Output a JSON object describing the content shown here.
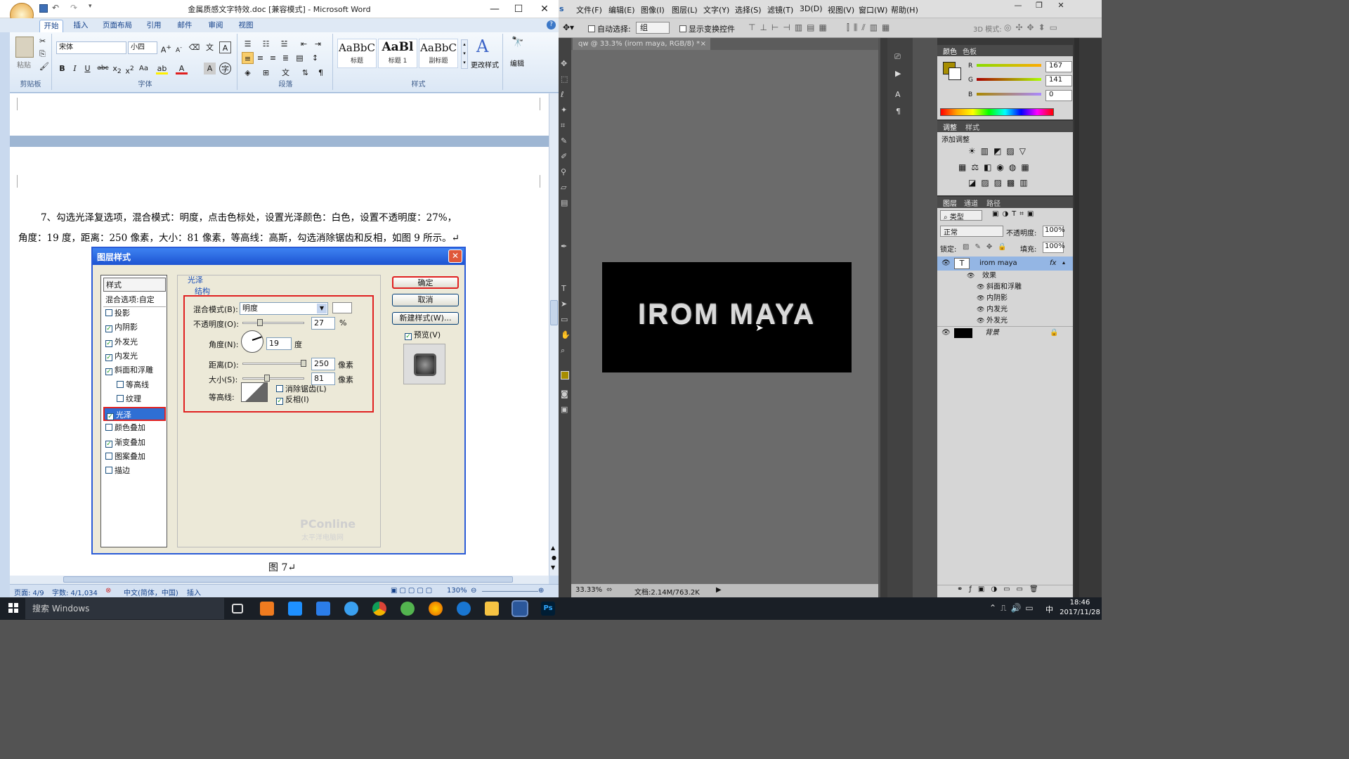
{
  "word": {
    "title": "金属质感文字特效.doc [兼容模式] - Microsoft Word",
    "tabs": [
      "开始",
      "插入",
      "页面布局",
      "引用",
      "邮件",
      "审阅",
      "视图"
    ],
    "font_name": "宋体",
    "font_size": "小四",
    "clipboard_group": "剪贴板",
    "paste_label": "粘贴",
    "font_group": "字体",
    "paragraph_group": "段落",
    "styles_group": "样式",
    "styles": [
      {
        "preview": "AaBbC",
        "name": "标题"
      },
      {
        "preview": "AaBl",
        "name": "标题 1"
      },
      {
        "preview": "AaBbC",
        "name": "副标题"
      }
    ],
    "change_styles": "更改样式",
    "edit_label": "编辑",
    "para_line1": "7、勾选光泽复选项，混合模式：明度，点击色标处，设置光泽颜色：白色，设置不透明度：27%，",
    "para_line2": "角度：19 度，距离：250 像素，大小：81 像素，等高线：高斯，勾选消除锯齿和反相，如图 9 所示。↵",
    "caption": "图 7↵",
    "status": {
      "page": "页面: 4/9",
      "words": "字数: 4/1,034",
      "lang": "中文(简体，中国)",
      "mode": "插入",
      "zoom": "130%"
    },
    "dialog": {
      "title": "图层样式",
      "list": [
        {
          "label": "样式",
          "checked": null
        },
        {
          "label": "混合选项:自定",
          "checked": null
        },
        {
          "label": "投影",
          "checked": false
        },
        {
          "label": "内阴影",
          "checked": true
        },
        {
          "label": "外发光",
          "checked": true
        },
        {
          "label": "内发光",
          "checked": true
        },
        {
          "label": "斜面和浮雕",
          "checked": true
        },
        {
          "label": "等高线",
          "checked": false
        },
        {
          "label": "纹理",
          "checked": false
        },
        {
          "label": "光泽",
          "checked": true
        },
        {
          "label": "颜色叠加",
          "checked": false
        },
        {
          "label": "渐变叠加",
          "checked": true
        },
        {
          "label": "图案叠加",
          "checked": false
        },
        {
          "label": "描边",
          "checked": false
        }
      ],
      "section": "光泽",
      "subsection": "结构",
      "blend_label": "混合模式(B):",
      "blend_value": "明度",
      "opacity_label": "不透明度(O):",
      "opacity_value": "27",
      "percent": "%",
      "angle_label": "角度(N):",
      "angle_value": "19",
      "degree": "度",
      "distance_label": "距离(D):",
      "distance_value": "250",
      "size_label": "大小(S):",
      "size_value": "81",
      "pixel": "像素",
      "contour_label": "等高线:",
      "antialias": "消除锯齿(L)",
      "invert": "反相(I)",
      "ok": "确定",
      "cancel": "取消",
      "new_style": "新建样式(W)...",
      "preview": "预览(V)",
      "watermark": "PConline",
      "watermark_sub": "太平洋电脑网"
    }
  },
  "ps": {
    "menu": [
      "文件(F)",
      "编辑(E)",
      "图像(I)",
      "图层(L)",
      "文字(Y)",
      "选择(S)",
      "滤镜(T)",
      "3D(D)",
      "视图(V)",
      "窗口(W)",
      "帮助(H)"
    ],
    "auto_select": "自动选择:",
    "auto_select_value": "组",
    "show_transform": "显示变换控件",
    "mode_3d": "3D 模式:",
    "doc_tab": "qw @ 33.3% (irom maya, RGB/8) *",
    "canvas_text": "IROM MAYA",
    "zoom": "33.33%",
    "doc_size": "文档:2.14M/763.2K",
    "color_panel": {
      "tab1": "颜色",
      "tab2": "色板",
      "r": "167",
      "g": "141",
      "b": "0",
      "fg": "#a78d00"
    },
    "adjust_panel": {
      "tab1": "调整",
      "tab2": "样式",
      "add": "添加调整"
    },
    "layers_panel": {
      "tabs": [
        "图层",
        "通道",
        "路径"
      ],
      "filter": "类型",
      "blend": "正常",
      "opacity_label": "不透明度:",
      "opacity": "100%",
      "lock_label": "锁定:",
      "fill_label": "填充:",
      "fill": "100%",
      "layer_name": "irom maya",
      "effects": "效果",
      "effect_items": [
        "斜面和浮雕",
        "内阴影",
        "内发光",
        "外发光"
      ],
      "bg_name": "背景"
    }
  },
  "taskbar": {
    "search": "搜索 Windows",
    "time": "18:46",
    "date": "2017/11/28",
    "ime": "中"
  }
}
